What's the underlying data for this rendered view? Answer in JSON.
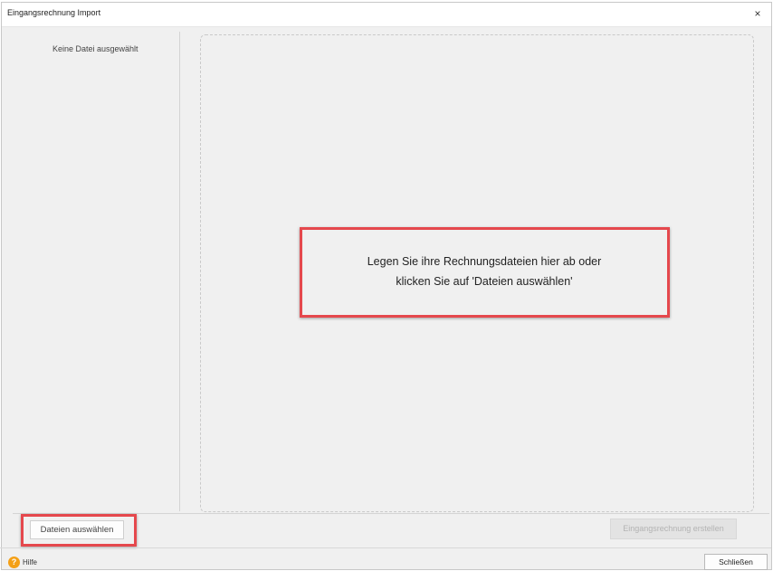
{
  "window": {
    "title": "Eingangsrechnung Import",
    "close_icon": "×"
  },
  "left_panel": {
    "status": "Keine Datei ausgewählt"
  },
  "dropzone": {
    "line1": "Legen Sie ihre Rechnungsdateien hier ab oder",
    "line2": "klicken Sie auf 'Dateien auswählen'"
  },
  "actions": {
    "select_files": "Dateien auswählen",
    "create_invoice": "Eingangsrechnung erstellen"
  },
  "footer": {
    "help_icon": "?",
    "help_label": "Hilfe",
    "close_label": "Schließen"
  },
  "colors": {
    "highlight": "#e5484d",
    "help_icon": "#f4a017"
  }
}
